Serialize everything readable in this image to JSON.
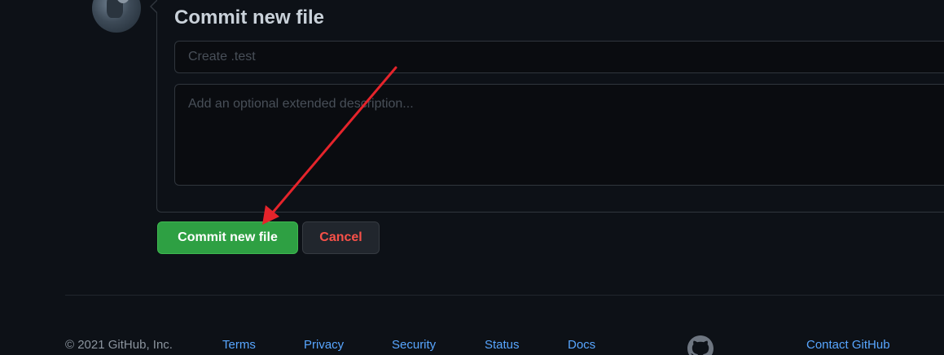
{
  "commit": {
    "title": "Commit new file",
    "summary_placeholder": "Create .test",
    "description_placeholder": "Add an optional extended description..."
  },
  "actions": {
    "commit_label": "Commit new file",
    "cancel_label": "Cancel"
  },
  "footer": {
    "copyright": "© 2021 GitHub, Inc.",
    "links": [
      "Terms",
      "Privacy",
      "Security",
      "Status",
      "Docs",
      "Contact GitHub"
    ]
  },
  "icons": {
    "footer_logo": "github-mark-icon",
    "avatar": "user-avatar"
  },
  "colors": {
    "background": "#0d1117",
    "primary_button": "#2ea043",
    "danger_text": "#f85149",
    "link": "#58a6ff",
    "annotation_arrow": "#e5242b"
  }
}
